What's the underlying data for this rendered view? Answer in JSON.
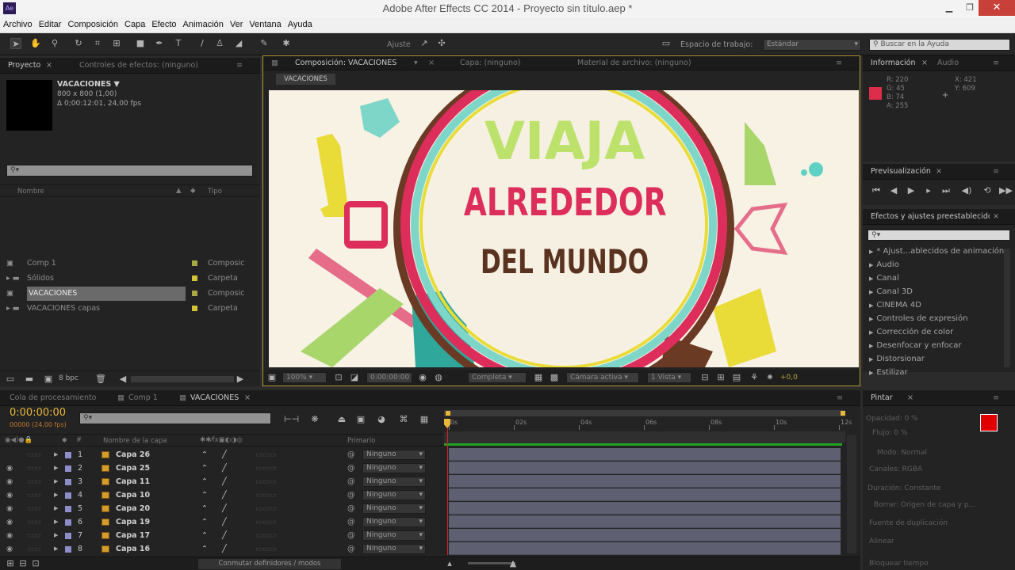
{
  "window": {
    "title": "Adobe After Effects CC 2014 - Proyecto sin título.aep *",
    "app_icon": "Ae"
  },
  "menu": [
    "Archivo",
    "Editar",
    "Composición",
    "Capa",
    "Efecto",
    "Animación",
    "Ver",
    "Ventana",
    "Ayuda"
  ],
  "toolbar": {
    "align_label": "Ajuste",
    "workspace_label": "Espacio de trabajo:",
    "workspace_value": "Estándar",
    "help_placeholder": "Buscar en la Ayuda"
  },
  "project": {
    "tab": "Proyecto",
    "tab2": "Controles de efectos: (ninguno)",
    "comp_name": "VACACIONES ▼",
    "comp_size": "800 x 800 (1,00)",
    "comp_dur": "Δ 0;00:12:01, 24,00 fps",
    "col_name": "Nombre",
    "col_type": "Tipo",
    "items": [
      {
        "name": "Comp 1",
        "type": "Composic",
        "color": "#a8a847"
      },
      {
        "name": "Sólidos",
        "type": "Carpeta",
        "color": "#d4c23a"
      },
      {
        "name": "VACACIONES",
        "type": "Composic",
        "color": "#a8a847"
      },
      {
        "name": "VACACIONES capas",
        "type": "Carpeta",
        "color": "#d4c23a"
      }
    ],
    "bpc": "8 bpc"
  },
  "viewer": {
    "tab": "Composición: VACACIONES",
    "tab2": "Capa: (ninguno)",
    "tab3": "Material de archivo: (ninguno)",
    "crumb": "VACACIONES",
    "line1": "VIAJA",
    "line2": "ALREDEDOR",
    "line3": "DEL MUNDO",
    "zoom": "100%",
    "time": "0:00:00:00",
    "resolution": "Completa",
    "camera": "Cámara activa",
    "views": "1 Vista",
    "exposure": "+0,0"
  },
  "info": {
    "tab": "Información",
    "tab2": "Audio",
    "r": "R:  220",
    "g": "G:  45",
    "b": "B:  74",
    "a": "A:  255",
    "x": "X:  421",
    "y": "Y:  609",
    "color": "#dc2d4a"
  },
  "preview": {
    "tab": "Previsualización"
  },
  "effects": {
    "tab": "Efectos y ajustes preestablecidos",
    "items": [
      "* Ajust...ablecidos de animación",
      "Audio",
      "Canal",
      "Canal 3D",
      "CINEMA 4D",
      "Controles de expresión",
      "Corrección de color",
      "Desenfocar y enfocar",
      "Distorsionar",
      "Estilizar"
    ]
  },
  "timeline": {
    "tabs": [
      "Cola de procesamiento",
      "Comp 1",
      "VACACIONES"
    ],
    "timecode": "0:00:00:00",
    "fps": "00000 (24,00 fps)",
    "col_name": "Nombre de la capa",
    "col_parent": "Primario",
    "toggle": "Conmutar definidores / modos",
    "ruler": [
      "0s",
      "02s",
      "04s",
      "06s",
      "08s",
      "10s",
      "12s"
    ],
    "layers": [
      {
        "n": "1",
        "name": "Capa 26",
        "parent": "Ninguno"
      },
      {
        "n": "2",
        "name": "Capa 25",
        "parent": "Ninguno"
      },
      {
        "n": "3",
        "name": "Capa 11",
        "parent": "Ninguno"
      },
      {
        "n": "4",
        "name": "Capa 10",
        "parent": "Ninguno"
      },
      {
        "n": "5",
        "name": "Capa 20",
        "parent": "Ninguno"
      },
      {
        "n": "6",
        "name": "Capa 19",
        "parent": "Ninguno"
      },
      {
        "n": "7",
        "name": "Capa 17",
        "parent": "Ninguno"
      },
      {
        "n": "8",
        "name": "Capa 16",
        "parent": "Ninguno"
      }
    ]
  },
  "paint": {
    "tab": "Pintar",
    "opacity": "Opacidad: 0 %",
    "flow": "Flujo: 0 %",
    "mode": "Modo:  Normal",
    "channels": "Canales:  RGBA",
    "duration": "Duración:  Constante",
    "erase": "Borrar:  Origen de capa y p...",
    "source": "Fuente de duplicación",
    "align": "Alinear",
    "lock": "Bloquear  tiempo",
    "fg": "#e10000",
    "bg": "#ffffff"
  }
}
